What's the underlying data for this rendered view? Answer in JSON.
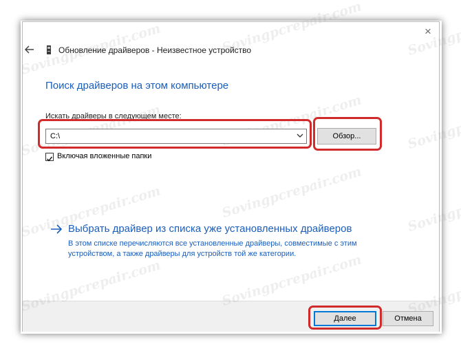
{
  "window": {
    "title": "Обновление драйверов - Неизвестное устройство",
    "close_glyph": "×"
  },
  "page": {
    "heading": "Поиск драйверов на этом компьютере",
    "field_label": "Искать драйверы в следующем месте:",
    "path_value": "C:\\",
    "browse_label": "Обзор...",
    "include_subfolders_label": "Включая вложенные папки",
    "include_subfolders_checked": true,
    "pick_link": "Выбрать драйвер из списка уже установленных драйверов",
    "pick_desc_line1": "В этом списке перечисляются все установленные драйверы, совместимые с этим",
    "pick_desc_line2": "устройством, а также драйверы для устройств той же категории."
  },
  "footer": {
    "next_label": "Далее",
    "cancel_label": "Отмена"
  },
  "watermark_text": "Sovingpcrepair.com",
  "colors": {
    "accent_blue": "#1a5ebc",
    "highlight_red": "#d12a2a",
    "button_focus": "#0078d7"
  }
}
